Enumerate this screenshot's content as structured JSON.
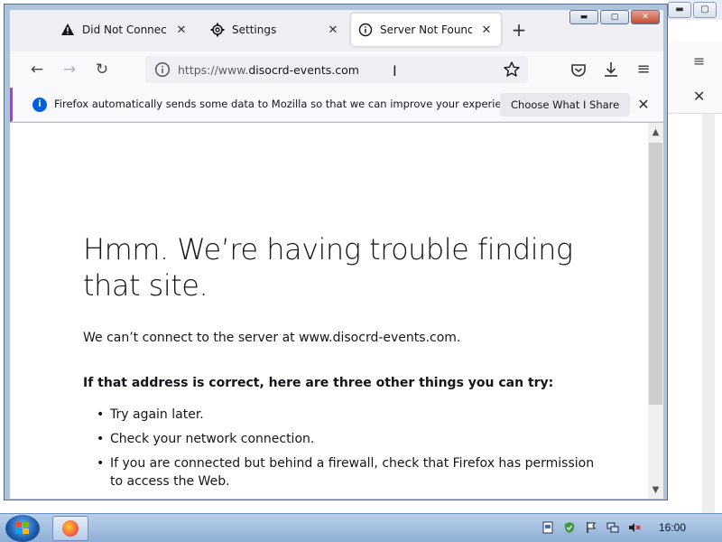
{
  "browser": {
    "tabs": [
      {
        "label": "Did Not Connect: Po",
        "icon": "warning-icon",
        "active": false
      },
      {
        "label": "Settings",
        "icon": "gear-icon",
        "active": false
      },
      {
        "label": "Server Not Found",
        "icon": "info-icon",
        "active": true
      }
    ],
    "tab_close_glyph": "✕",
    "new_tab_glyph": "+",
    "window_controls": {
      "minimize": "▬",
      "maximize": "▢",
      "close": "✕"
    },
    "url": {
      "scheme": "https://www.",
      "host": "disocrd-events.com"
    },
    "nav": {
      "back": "←",
      "forward": "→",
      "reload": "↻"
    },
    "menu_glyph": "≡"
  },
  "notice": {
    "text": "Firefox automatically sends some data to Mozilla so that we can improve your experience.",
    "button": "Choose What I Share",
    "close": "✕",
    "icon": "i"
  },
  "error_page": {
    "title": "Hmm. We’re having trouble finding that site.",
    "description": "We can’t connect to the server at www.disocrd-events.com.",
    "subheading": "If that address is correct, here are three other things you can try:",
    "suggestions": [
      "Try again later.",
      "Check your network connection.",
      "If you are connected but behind a firewall, check that Firefox has permission to access the Web."
    ]
  },
  "background_window": {
    "menu_glyph": "≡",
    "close_glyph": "✕"
  },
  "taskbar": {
    "clock": "16:00"
  },
  "colors": {
    "accent": "#0060df",
    "notice_border": "#b833e1",
    "taskbar": "#8eaed5"
  }
}
